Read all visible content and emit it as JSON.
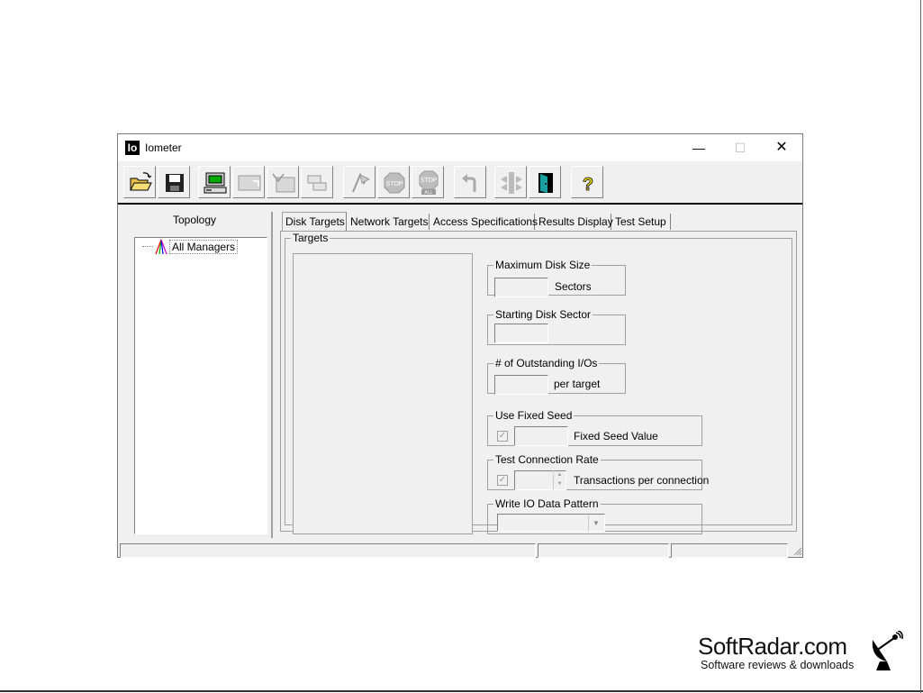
{
  "window": {
    "title": "Iometer",
    "app_icon_text": "Io",
    "controls": {
      "minimize": "—",
      "maximize": "☐",
      "close": "✕"
    }
  },
  "toolbar": {
    "buttons": [
      {
        "name": "open-config",
        "icon": "folder-open-icon"
      },
      {
        "name": "save-config",
        "icon": "floppy-disk-icon"
      },
      {
        "name": "start-new-disk-worker",
        "icon": "computer-icon"
      },
      {
        "name": "start-new-network-worker",
        "icon": "network-worker-icon"
      },
      {
        "name": "duplicate-worker",
        "icon": "duplicate-icon"
      },
      {
        "name": "disconnect-manager",
        "icon": "disconnect-icon"
      },
      {
        "name": "start-tests",
        "icon": "green-flag-icon"
      },
      {
        "name": "stop-test",
        "icon": "stop-icon"
      },
      {
        "name": "stop-all",
        "icon": "stop-all-icon"
      },
      {
        "name": "reset-workers",
        "icon": "undo-icon"
      },
      {
        "name": "exit",
        "icon": "exit-door-icon"
      },
      {
        "name": "help",
        "icon": "help-icon"
      }
    ],
    "stop_label": "STOP",
    "stop_all_label_top": "STOP",
    "stop_all_label_bottom": "ALL",
    "help_glyph": "?"
  },
  "topology": {
    "label": "Topology",
    "tree": [
      {
        "label": "All Managers"
      }
    ]
  },
  "tabs": [
    {
      "label": "Disk Targets",
      "active": true
    },
    {
      "label": "Network Targets"
    },
    {
      "label": "Access Specifications"
    },
    {
      "label": "Results Display"
    },
    {
      "label": "Test Setup"
    }
  ],
  "disk_targets": {
    "targets_legend": "Targets",
    "max_disk_size": {
      "legend": "Maximum Disk Size",
      "value": "",
      "suffix": "Sectors"
    },
    "starting_disk_sector": {
      "legend": "Starting Disk Sector",
      "value": ""
    },
    "outstanding_ios": {
      "legend": "# of Outstanding I/Os",
      "value": "",
      "suffix": "per target"
    },
    "use_fixed_seed": {
      "legend": "Use Fixed Seed",
      "checked": true,
      "value": "",
      "suffix": "Fixed Seed Value"
    },
    "test_connection_rate": {
      "legend": "Test Connection Rate",
      "checked": true,
      "value": "",
      "suffix": "Transactions per connection"
    },
    "write_io_pattern": {
      "legend": "Write IO Data Pattern",
      "selected": ""
    },
    "check_glyph": "✓",
    "spin_up": "▲",
    "spin_down": "▼",
    "combo_glyph": "▼"
  },
  "watermark": {
    "name": "SoftRadar.com",
    "tagline": "Software reviews & downloads",
    "icon": "satellite-dish-icon"
  }
}
